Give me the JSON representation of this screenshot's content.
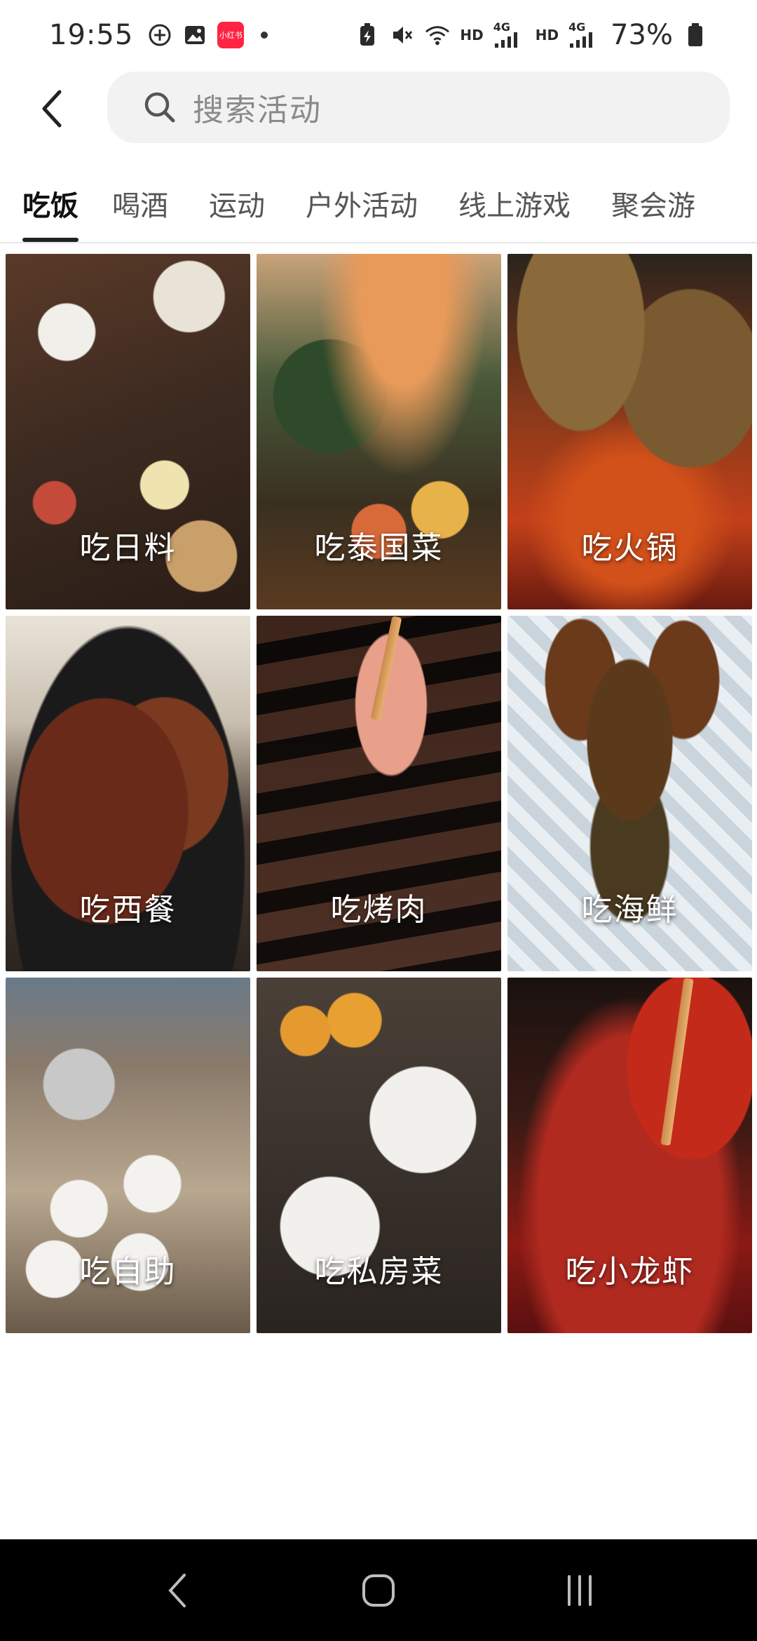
{
  "status_bar": {
    "time": "19:55",
    "app_badge": "小红书",
    "hd1": "HD",
    "hd2": "HD",
    "net1": "4G",
    "net2": "4G",
    "battery": "73%"
  },
  "search": {
    "placeholder": "搜索活动"
  },
  "tabs": [
    {
      "label": "吃饭",
      "active": true
    },
    {
      "label": "喝酒",
      "active": false
    },
    {
      "label": "运动",
      "active": false
    },
    {
      "label": "户外活动",
      "active": false
    },
    {
      "label": "线上游戏",
      "active": false
    },
    {
      "label": "聚会游",
      "active": false
    }
  ],
  "cards": [
    {
      "label": "吃日料",
      "image": "japanese-food"
    },
    {
      "label": "吃泰国菜",
      "image": "thai-food"
    },
    {
      "label": "吃火锅",
      "image": "hotpot"
    },
    {
      "label": "吃西餐",
      "image": "steak"
    },
    {
      "label": "吃烤肉",
      "image": "bbq"
    },
    {
      "label": "吃海鲜",
      "image": "lobster"
    },
    {
      "label": "吃自助",
      "image": "buffet"
    },
    {
      "label": "吃私房菜",
      "image": "private-kitchen"
    },
    {
      "label": "吃小龙虾",
      "image": "crayfish"
    }
  ],
  "colors": {
    "accent_underline": "#222222",
    "search_bg": "#f2f2f2",
    "nav_bg": "#000000"
  }
}
